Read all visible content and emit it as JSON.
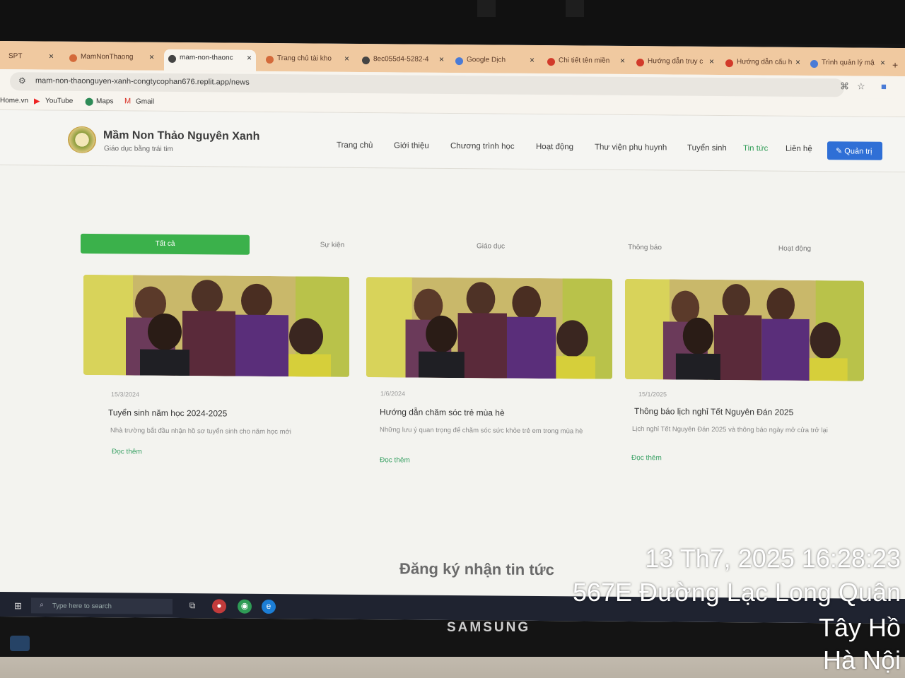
{
  "browser": {
    "tabs": [
      {
        "label": "SPT",
        "icon_color": "#999999"
      },
      {
        "label": "MamNonThaong",
        "icon_color": "#d46a3a"
      },
      {
        "label": "mam-non-thaonc",
        "icon_color": "#444444"
      },
      {
        "label": "Trang chủ tài kho",
        "icon_color": "#d46a3a"
      },
      {
        "label": "8ec055d4-5282-4",
        "icon_color": "#444444"
      },
      {
        "label": "Google Dịch",
        "icon_color": "#4a7bd6"
      },
      {
        "label": "Chi tiết tên miền",
        "icon_color": "#d23a2a"
      },
      {
        "label": "Hướng dẫn truy c",
        "icon_color": "#d23a2a"
      },
      {
        "label": "Hướng dẫn cấu h",
        "icon_color": "#d23a2a"
      },
      {
        "label": "Trình quản lý mậ",
        "icon_color": "#4a7bd6"
      }
    ],
    "url": "mam-non-thaonguyen-xanh-congtycophan676.replit.app/news",
    "bookmarks": [
      "Home.vn",
      "YouTube",
      "Maps",
      "Gmail"
    ]
  },
  "site": {
    "title": "Mầm Non Thảo Nguyên Xanh",
    "subtitle": "Giáo dục bằng trái tim",
    "nav": [
      "Trang chủ",
      "Giới thiệu",
      "Chương trình học",
      "Hoạt động",
      "Thư viện phụ huynh",
      "Tuyển sinh",
      "Tin tức",
      "Liên hệ"
    ],
    "active_nav": "Tin tức",
    "admin_label": "Quản trị",
    "accent": "#2f9c56",
    "admin_color": "#2f6fd6"
  },
  "filters": [
    "Tất cả",
    "Sự kiện",
    "Giáo dục",
    "Thông báo",
    "Hoạt động"
  ],
  "news": [
    {
      "date": "15/3/2024",
      "title": "Tuyển sinh năm học 2024-2025",
      "excerpt": "Nhà trường bắt đầu nhận hồ sơ tuyển sinh cho năm học mới",
      "more": "Đọc thêm"
    },
    {
      "date": "1/6/2024",
      "title": "Hướng dẫn chăm sóc trẻ mùa hè",
      "excerpt": "Những lưu ý quan trọng để chăm sóc sức khỏe trẻ em trong mùa hè",
      "more": "Đọc thêm"
    },
    {
      "date": "15/1/2025",
      "title": "Thông báo lịch nghỉ Tết Nguyên Đán 2025",
      "excerpt": "Lịch nghỉ Tết Nguyên Đán 2025 và thông báo ngày mở cửa trở lại",
      "more": "Đọc thêm"
    }
  ],
  "newsletter_title": "Đăng ký nhận tin tức",
  "taskbar": {
    "search_placeholder": "Type here to search"
  },
  "monitor_brand": "SAMSUNG",
  "photo_stamp": {
    "datetime": "13 Th7, 2025 16:28:23",
    "address": "567E Đường Lạc Long Quân",
    "district": "Tây Hồ",
    "city": "Hà Nội"
  }
}
